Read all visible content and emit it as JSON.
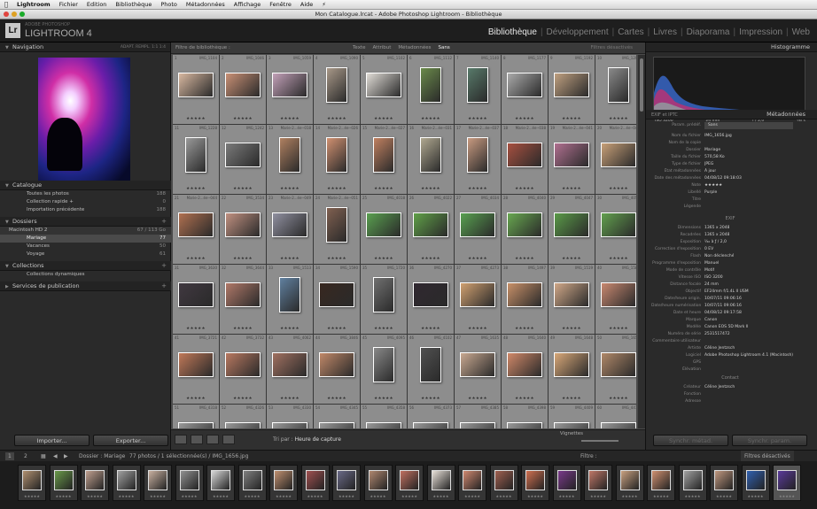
{
  "menubar": {
    "apple": "",
    "items": [
      "Lightroom",
      "Fichier",
      "Edition",
      "Bibliothèque",
      "Photo",
      "Métadonnées",
      "Affichage",
      "Fenêtre",
      "Aide"
    ],
    "script_icon": "lightning-icon"
  },
  "window": {
    "title": "Mon Catalogue.lrcat - Adobe Photoshop Lightroom - Bibliothèque"
  },
  "identity": {
    "logo": "Lr",
    "brand_small": "ADOBE PHOTOSHOP",
    "brand": "LIGHTROOM 4"
  },
  "modules": [
    "Bibliothèque",
    "Développement",
    "Cartes",
    "Livres",
    "Diaporama",
    "Impression",
    "Web"
  ],
  "active_module": "Bibliothèque",
  "left": {
    "navigator": {
      "title": "Navigation",
      "zoom_options": "ADAPT.  REMPL.  1:1  1:4"
    },
    "catalogue": {
      "title": "Catalogue",
      "items": [
        {
          "label": "Toutes les photos",
          "count": "188"
        },
        {
          "label": "Collection rapide +",
          "count": "0"
        },
        {
          "label": "Importation précédente",
          "count": "188"
        }
      ]
    },
    "folders": {
      "title": "Dossiers",
      "volume": "Macintosh HD 2",
      "volume_info": "67 / 113 Go",
      "items": [
        {
          "label": "Mariage",
          "count": "77"
        },
        {
          "label": "Vacances",
          "count": "50"
        },
        {
          "label": "Voyage",
          "count": "61"
        }
      ]
    },
    "collections": {
      "title": "Collections",
      "items": [
        "Collections dynamiques"
      ]
    },
    "publish": {
      "title": "Services de publication"
    },
    "import_label": "Importer...",
    "export_label": "Exporter..."
  },
  "center": {
    "filter": {
      "title": "Filtre de bibliothèque :",
      "options": [
        "Texte",
        "Attribut",
        "Métadonnées",
        "Sans"
      ],
      "active": "Sans",
      "status": "Filtres désactivés"
    },
    "toolbar": {
      "sort_label": "Tri par :",
      "sort_value": "Heure de capture",
      "thumbs_label": "Vignettes"
    }
  },
  "grid": {
    "cells": [
      {
        "i": "1",
        "f": "IMG_1104",
        "c": "#d8b8a0",
        "o": "l",
        "r": "★★★★★"
      },
      {
        "i": "2",
        "f": "IMG_1046",
        "c": "#c99075",
        "o": "l",
        "r": "★★★★★"
      },
      {
        "i": "3",
        "f": "IMG_1059",
        "c": "#c2a0b8",
        "o": "l",
        "r": "★★★★★"
      },
      {
        "i": "4",
        "f": "IMG_1090",
        "c": "#a89888",
        "o": "p",
        "r": "★★★★★"
      },
      {
        "i": "5",
        "f": "IMG_1102",
        "c": "#e0dcd6",
        "o": "l",
        "r": "★★★★★"
      },
      {
        "i": "6",
        "f": "IMG_1112",
        "c": "#6a8a4a",
        "o": "p",
        "r": "★★★★★"
      },
      {
        "i": "7",
        "f": "IMG_1140",
        "c": "#587a6a",
        "o": "p",
        "r": "★★★★★"
      },
      {
        "i": "8",
        "f": "IMG_1177",
        "c": "#aaaaaa",
        "o": "l",
        "r": "★★★★★"
      },
      {
        "i": "9",
        "f": "IMG_1192",
        "c": "#bfa080",
        "o": "l",
        "r": "★★★★★"
      },
      {
        "i": "10",
        "f": "IMG_1206",
        "c": "#8a8a8a",
        "o": "p",
        "r": "★★★★★"
      },
      {
        "i": "11",
        "f": "IMG_1228",
        "c": "#999999",
        "o": "p",
        "r": "★★★★★"
      },
      {
        "i": "12",
        "f": "IMG_1242",
        "c": "#7a7a7a",
        "o": "l",
        "r": "★★★★★"
      },
      {
        "i": "13",
        "f": "Marie-2...ée--018",
        "c": "#b08060",
        "o": "p",
        "r": "★★★★★"
      },
      {
        "i": "14",
        "f": "Marie-2...ée--026",
        "c": "#d09070",
        "o": "p",
        "r": "★★★★★"
      },
      {
        "i": "15",
        "f": "Marie-2...ée--027",
        "c": "#c08060",
        "o": "p",
        "r": "★★★★★"
      },
      {
        "i": "16",
        "f": "Marie-2...ée--031",
        "c": "#b0a890",
        "o": "p",
        "r": "★★★★★"
      },
      {
        "i": "17",
        "f": "Marie-2...ée--037",
        "c": "#c89a80",
        "o": "p",
        "r": "★★★★★"
      },
      {
        "i": "18",
        "f": "Marie-2...ée--038",
        "c": "#a85040",
        "o": "l",
        "r": "★★★★★"
      },
      {
        "i": "19",
        "f": "Marie-2...ée--041",
        "c": "#b07090",
        "o": "l",
        "r": "★★★★★"
      },
      {
        "i": "20",
        "f": "Marie-2...ée--043",
        "c": "#c8a078",
        "o": "l",
        "r": "★★★★★"
      },
      {
        "i": "21",
        "f": "Marie-2...ée--044",
        "c": "#b07050",
        "o": "l",
        "r": "★★★★★"
      },
      {
        "i": "22",
        "f": "IMG_3534",
        "c": "#c09080",
        "o": "l",
        "r": "★★★★★"
      },
      {
        "i": "23",
        "f": "Marie-2...ée--049",
        "c": "#9090a0",
        "o": "l",
        "r": "★★★★★"
      },
      {
        "i": "24",
        "f": "Marie-2...ée--051",
        "c": "#806050",
        "o": "p",
        "r": "★★★★★"
      },
      {
        "i": "25",
        "f": "IMG_4018",
        "c": "#5aa050",
        "o": "l",
        "r": "★★★★★"
      },
      {
        "i": "26",
        "f": "IMG_4022",
        "c": "#60a048",
        "o": "l",
        "r": "★★★★★"
      },
      {
        "i": "27",
        "f": "IMG_4034",
        "c": "#58a050",
        "o": "l",
        "r": "★★★★★"
      },
      {
        "i": "28",
        "f": "IMG_4040",
        "c": "#68a850",
        "o": "l",
        "r": "★★★★★"
      },
      {
        "i": "29",
        "f": "IMG_4047",
        "c": "#5a9a48",
        "o": "l",
        "r": "★★★★★"
      },
      {
        "i": "30",
        "f": "IMG_4055",
        "c": "#62a04e",
        "o": "l",
        "r": "★★★★★"
      },
      {
        "i": "31",
        "f": "IMG_3630",
        "c": "#403840",
        "o": "l",
        "r": "★★★★★"
      },
      {
        "i": "32",
        "f": "IMG_3644",
        "c": "#b07868",
        "o": "l",
        "r": "★★★★★"
      },
      {
        "i": "33",
        "f": "IMG_1513",
        "c": "#6080a0",
        "o": "p",
        "r": "★★★★★"
      },
      {
        "i": "34",
        "f": "IMG_1590",
        "c": "#382820",
        "o": "l",
        "r": "★★★★★"
      },
      {
        "i": "35",
        "f": "IMG_1720",
        "c": "#707070",
        "o": "p",
        "r": "★★★★★"
      },
      {
        "i": "36",
        "f": "IMG_4270",
        "c": "#302830",
        "o": "l",
        "r": "★★★★★"
      },
      {
        "i": "37",
        "f": "IMG_4273",
        "c": "#d0a070",
        "o": "l",
        "r": "★★★★★"
      },
      {
        "i": "38",
        "f": "IMG_1497",
        "c": "#c89068",
        "o": "l",
        "r": "★★★★★"
      },
      {
        "i": "39",
        "f": "IMG_1519",
        "c": "#d0a888",
        "o": "l",
        "r": "★★★★★"
      },
      {
        "i": "40",
        "f": "IMG_1582",
        "c": "#c88870",
        "o": "l",
        "r": "★★★★★"
      },
      {
        "i": "41",
        "f": "IMG_3721",
        "c": "#c07858",
        "o": "l",
        "r": "★★★★★"
      },
      {
        "i": "42",
        "f": "IMG_3732",
        "c": "#b87860",
        "o": "l",
        "r": "★★★★★"
      },
      {
        "i": "43",
        "f": "IMG_4062",
        "c": "#a07060",
        "o": "l",
        "r": "★★★★★"
      },
      {
        "i": "44",
        "f": "IMG_3846",
        "c": "#c08868",
        "o": "l",
        "r": "★★★★★"
      },
      {
        "i": "45",
        "f": "IMG_4095",
        "c": "#888888",
        "o": "p",
        "r": "★★★★★"
      },
      {
        "i": "46",
        "f": "IMG_4102",
        "c": "#505050",
        "o": "p",
        "r": "★★★★★"
      },
      {
        "i": "47",
        "f": "IMG_1635",
        "c": "#c8a890",
        "o": "l",
        "r": "★★★★★"
      },
      {
        "i": "48",
        "f": "IMG_1640",
        "c": "#d08868",
        "o": "l",
        "r": "★★★★★"
      },
      {
        "i": "49",
        "f": "IMG_1648",
        "c": "#d8a878",
        "o": "l",
        "r": "★★★★★"
      },
      {
        "i": "50",
        "f": "IMG_1656",
        "c": "#b08868",
        "o": "l",
        "r": "★★★★★"
      },
      {
        "i": "51",
        "f": "IMG_4318",
        "c": "#999999",
        "o": "l",
        "r": ""
      },
      {
        "i": "52",
        "f": "IMG_4326",
        "c": "#999999",
        "o": "l",
        "r": ""
      },
      {
        "i": "53",
        "f": "IMG_4330",
        "c": "#999999",
        "o": "l",
        "r": ""
      },
      {
        "i": "54",
        "f": "IMG_4345",
        "c": "#999999",
        "o": "l",
        "r": ""
      },
      {
        "i": "55",
        "f": "IMG_4358",
        "c": "#999999",
        "o": "l",
        "r": ""
      },
      {
        "i": "56",
        "f": "IMG_4373",
        "c": "#999999",
        "o": "l",
        "r": ""
      },
      {
        "i": "57",
        "f": "IMG_4385",
        "c": "#999999",
        "o": "l",
        "r": ""
      },
      {
        "i": "58",
        "f": "IMG_4398",
        "c": "#999999",
        "o": "l",
        "r": ""
      },
      {
        "i": "59",
        "f": "IMG_4409",
        "c": "#999999",
        "o": "l",
        "r": ""
      },
      {
        "i": "60",
        "f": "IMG_4418",
        "c": "#999999",
        "o": "l",
        "r": ""
      }
    ]
  },
  "right": {
    "histogram": {
      "title": "Histogramme",
      "iso": "ISO 3200",
      "focal": "24 mm",
      "aperture": "f / 2,0",
      "shutter": "¹⁄₄₀ s"
    },
    "metadata": {
      "title": "Métadonnées",
      "preset_label": "Param. prédéf.",
      "preset_value": "Sans",
      "panel_left": "EXIF et IPTC",
      "rows": [
        {
          "k": "Nom du fichier",
          "v": "IMG_1656.jpg"
        },
        {
          "k": "Nom de la copie",
          "v": ""
        },
        {
          "k": "Dossier",
          "v": "Mariage"
        },
        {
          "k": "Taille du fichier",
          "v": "570,58 Ko"
        },
        {
          "k": "Type de fichier",
          "v": "JPEG"
        },
        {
          "k": "État métadonnées",
          "v": "À jour"
        },
        {
          "k": "Date des métadonnées",
          "v": "04/08/12 09:18:03"
        },
        {
          "k": "Note",
          "v": "★★★★★"
        },
        {
          "k": "Libellé",
          "v": "Purple"
        },
        {
          "k": "Titre",
          "v": ""
        },
        {
          "k": "Légende",
          "v": ""
        }
      ],
      "exif_title": "EXIF",
      "exif": [
        {
          "k": "Dimensions",
          "v": "1365 x 2048"
        },
        {
          "k": "Recadrées",
          "v": "1365 x 2048"
        },
        {
          "k": "Exposition",
          "v": "¹⁄₄₀ à ƒ / 2,0"
        },
        {
          "k": "Correction d'exposition",
          "v": "0 EV"
        },
        {
          "k": "Flash",
          "v": "Non déclenché"
        },
        {
          "k": "Programme d'exposition",
          "v": "Manuel"
        },
        {
          "k": "Mode de contrôle",
          "v": "Motif"
        },
        {
          "k": "Vitesse ISO",
          "v": "ISO 3200"
        },
        {
          "k": "Distance focale",
          "v": "24 mm"
        },
        {
          "k": "Objectif",
          "v": "EF24mm f/1.4L II USM"
        },
        {
          "k": "Date/heure origin.",
          "v": "10/07/11 09:06:16"
        },
        {
          "k": "Date/heure numérisation",
          "v": "10/07/11 09:06:16"
        },
        {
          "k": "Date et heure",
          "v": "04/08/12 09:17:58"
        },
        {
          "k": "Marque",
          "v": "Canon"
        },
        {
          "k": "Modèle",
          "v": "Canon EOS 5D Mark II"
        },
        {
          "k": "Numéro de série",
          "v": "2531517472"
        },
        {
          "k": "Commentaire utilisateur",
          "v": ""
        },
        {
          "k": "Artiste",
          "v": "Céline Jentzsch"
        },
        {
          "k": "Logiciel",
          "v": "Adobe Photoshop Lightroom 4.1 (Macintosh)"
        },
        {
          "k": "GPS",
          "v": ""
        },
        {
          "k": "Élévation",
          "v": ""
        }
      ],
      "contact_title": "Contact",
      "contact": [
        {
          "k": "Créateur",
          "v": "Céline Jentzsch"
        },
        {
          "k": "Fonction",
          "v": ""
        },
        {
          "k": "Adresse",
          "v": ""
        }
      ]
    },
    "sync_meta_label": "Synchr. métad.",
    "sync_params_label": "Synchr. param."
  },
  "filmbar": {
    "pages": [
      "1",
      "2"
    ],
    "path": "Dossier : Mariage",
    "count": "77 photos / 1 sélectionnée(s) / IMG_1656.jpg",
    "filter_label": "Filtre :",
    "filter_value": "Filtres désactivés"
  },
  "filmstrip": [
    {
      "c": "#b09070"
    },
    {
      "c": "#6a9a4a"
    },
    {
      "c": "#c0a090"
    },
    {
      "c": "#a0a0a0"
    },
    {
      "c": "#c8b0a0"
    },
    {
      "c": "#909090"
    },
    {
      "c": "#d8d8d8"
    },
    {
      "c": "#808080"
    },
    {
      "c": "#c09070"
    },
    {
      "c": "#a05050"
    },
    {
      "c": "#6a6a88"
    },
    {
      "c": "#b08870"
    },
    {
      "c": "#c07060"
    },
    {
      "c": "#e8e0d8"
    },
    {
      "c": "#d08870"
    },
    {
      "c": "#a06050"
    },
    {
      "c": "#d07050"
    },
    {
      "c": "#7a3a8a"
    },
    {
      "c": "#c07868"
    },
    {
      "c": "#c8a080"
    },
    {
      "c": "#d09070"
    },
    {
      "c": "#a0a0a0"
    },
    {
      "c": "#c09880"
    },
    {
      "c": "#3060b0"
    },
    {
      "c": "#5a3a9a"
    }
  ],
  "colors": {
    "accent": "#e6e6e6",
    "panel": "#2a2a2a",
    "grid": "#8d8d8d"
  }
}
